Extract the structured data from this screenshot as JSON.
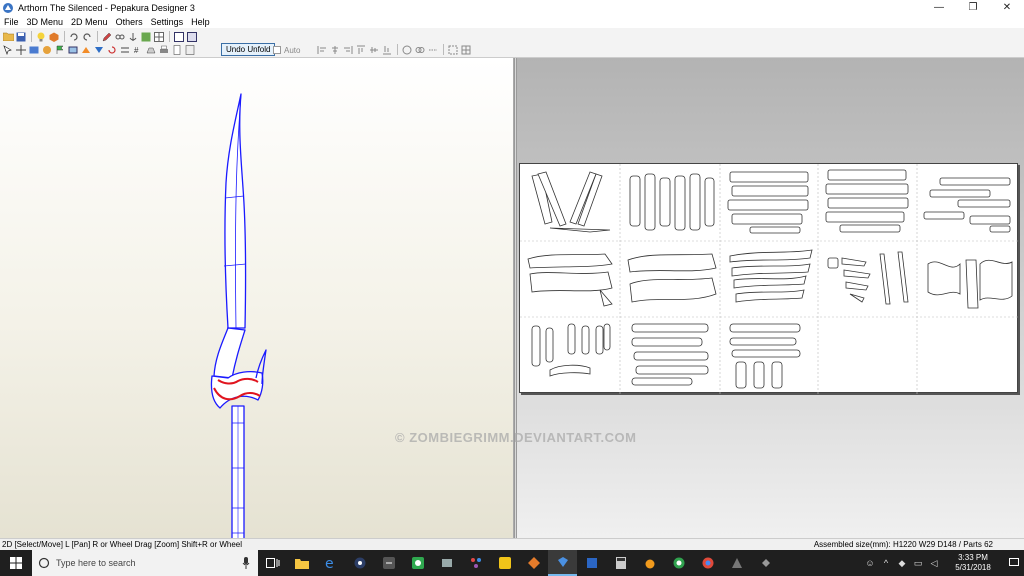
{
  "window": {
    "title": "Arthorn The Silenced - Pepakura Designer 3",
    "minimize": "—",
    "maximize": "❐",
    "close": "✕"
  },
  "menu": [
    "File",
    "3D Menu",
    "2D Menu",
    "Others",
    "Settings",
    "Help"
  ],
  "toolbar": {
    "undo_unfold": "Undo Unfold",
    "auto": "Auto"
  },
  "watermark": "© ZOMBIEGRIMM.DEVIANTART.COM",
  "status": {
    "left": "2D [Select/Move] L [Pan] R or Wheel Drag [Zoom] Shift+R or Wheel",
    "right": "Assembled size(mm): H1220 W29 D148 / Parts 62"
  },
  "taskbar": {
    "search_placeholder": "Type here to search",
    "time": "3:33 PM",
    "date": "5/31/2018"
  },
  "colors": {
    "mesh_blue": "#1a1aff",
    "mesh_red": "#e0141e",
    "taskbar": "#1f1f1f",
    "paper": "#ffffff"
  }
}
